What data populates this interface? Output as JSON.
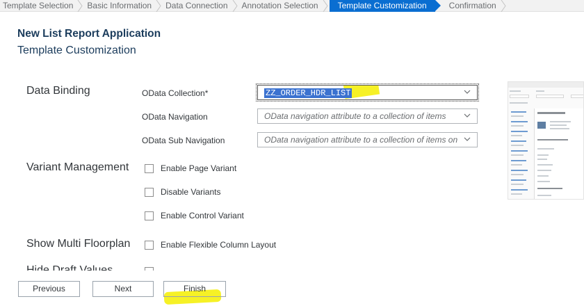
{
  "steps": [
    "Template Selection",
    "Basic Information",
    "Data Connection",
    "Annotation Selection",
    "Template Customization",
    "Confirmation"
  ],
  "active_step": "Template Customization",
  "app_title": "New List Report Application",
  "section_title": "Template Customization",
  "data_binding": {
    "label": "Data Binding",
    "odata_collection": {
      "label": "OData Collection*",
      "value": "ZZ_ORDER_HDR_LIST"
    },
    "odata_navigation": {
      "label": "OData Navigation",
      "placeholder": "OData navigation attribute to a collection of items"
    },
    "odata_sub_navigation": {
      "label": "OData Sub Navigation",
      "placeholder": "OData navigation attribute to a collection of items on s"
    }
  },
  "variant_management": {
    "label": "Variant Management",
    "options": [
      {
        "label": "Enable Page Variant",
        "checked": false
      },
      {
        "label": "Disable Variants",
        "checked": false
      },
      {
        "label": "Enable Control Variant",
        "checked": false
      }
    ]
  },
  "multi_floorplan": {
    "label": "Show Multi Floorplan",
    "option": {
      "label": "Enable Flexible Column Layout",
      "checked": false
    }
  },
  "cut_off_group_label": "Hide Draft Values",
  "footer": {
    "previous": "Previous",
    "next": "Next",
    "finish": "Finish"
  },
  "highlight_color": "#f5ee00",
  "accent_color": "#0a6ed1",
  "preview_icon": "template-preview-thumbnail"
}
